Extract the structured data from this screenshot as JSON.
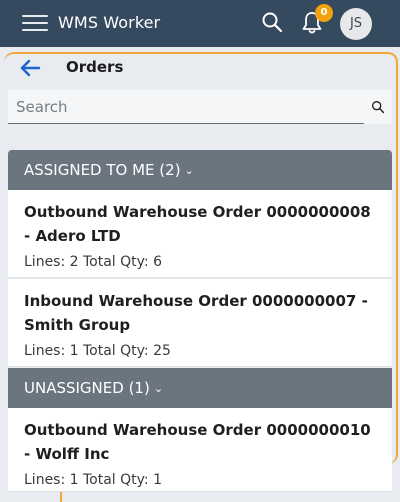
{
  "app": {
    "title": "WMS Worker"
  },
  "notifications": {
    "count": "0"
  },
  "user": {
    "initials": "JS"
  },
  "page": {
    "title": "Orders"
  },
  "search": {
    "placeholder": "Search",
    "value": ""
  },
  "groups": [
    {
      "label": "ASSIGNED TO ME (2)",
      "orders": [
        {
          "title": "Outbound Warehouse Order 0000000008 - Adero LTD",
          "summary": "Lines: 2 Total Qty: 6"
        },
        {
          "title": "Inbound Warehouse Order 0000000007 - Smith Group",
          "summary": "Lines: 1 Total Qty: 25"
        }
      ]
    },
    {
      "label": "UNASSIGNED (1)",
      "orders": [
        {
          "title": "Outbound Warehouse Order 0000000010 - Wolff Inc",
          "summary": "Lines: 1 Total Qty: 1"
        }
      ]
    }
  ],
  "icons": {
    "menu": "hamburger-icon",
    "search": "search-icon",
    "bell": "bell-icon",
    "back": "arrow-left-icon",
    "chevron": "chevron-down-icon"
  },
  "colors": {
    "topbar": "#354a5f",
    "group_header": "#6b7580",
    "accent": "#1a66cc",
    "badge": "#f2a20e"
  }
}
